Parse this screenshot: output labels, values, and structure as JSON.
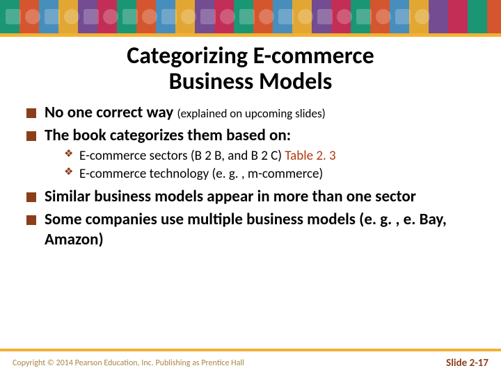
{
  "title_line1": "Categorizing E-commerce",
  "title_line2": "Business Models",
  "bullets": {
    "b1_strong": "No one correct way ",
    "b1_note": "(explained on upcoming slides)",
    "b2": "The book categorizes them based on:",
    "b2_sub1_pre": "E-commerce sectors (B 2 B, and B 2 C) ",
    "b2_sub1_hl": "Table 2. 3",
    "b2_sub2": "E-commerce technology (e. g. , m-commerce)",
    "b3": "Similar business models appear in more than one sector",
    "b4": "Some companies use multiple business models (e. g. , e. Bay, Amazon)"
  },
  "footer": {
    "copyright": "Copyright © 2014 Pearson Education, Inc. Publishing as Prentice Hall",
    "pager": "Slide 2-17"
  }
}
